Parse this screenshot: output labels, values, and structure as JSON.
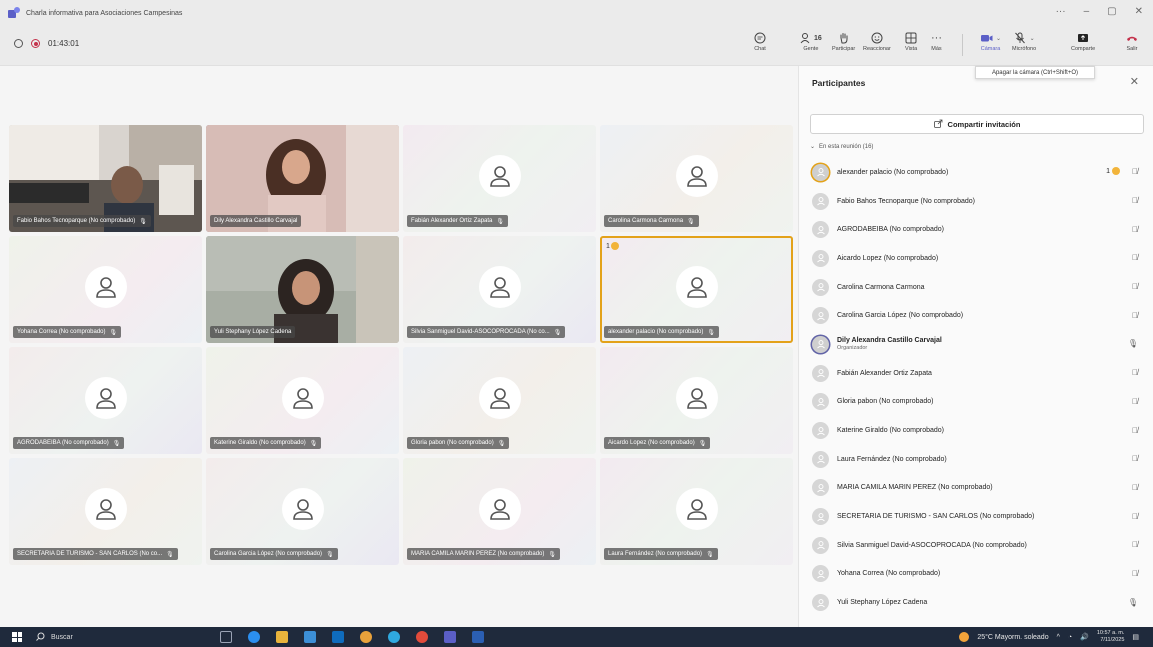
{
  "window": {
    "title": "Charla informativa para Asociaciones Campesinas",
    "controls": [
      "···",
      "–",
      "▢",
      "✕"
    ]
  },
  "meeting": {
    "timer": "01:43:01"
  },
  "toolbar": {
    "chat": "Chat",
    "people": "Gente",
    "people_count": "16",
    "raise": "Participar",
    "react": "Reaccionar",
    "view": "Vista",
    "more": "Más",
    "camera": "Cámara",
    "mic": "Micrófono",
    "share": "Comparte",
    "leave": "Salir",
    "camera_tooltip": "Apagar la cámara (Ctrl+Shift+O)"
  },
  "tiles": [
    {
      "name": "Fabio Bahos Tecnoparque (No comprobado)",
      "camera": true
    },
    {
      "name": "Dily Alexandra Castillo Carvajal",
      "camera": true
    },
    {
      "name": "Fabián Alexander Ortiz Zapata",
      "camera": false
    },
    {
      "name": "Carolina Carmona Carmona",
      "camera": false
    },
    {
      "name": "Yohana Correa (No comprobado)",
      "camera": false
    },
    {
      "name": "Yuli Stephany López Cadena",
      "camera": true
    },
    {
      "name": "Silvia Sanmiguel David-ASOCOPROCADA (No co...",
      "camera": false
    },
    {
      "name": "alexander palacio (No comprobado)",
      "camera": false,
      "hand_count": "1"
    },
    {
      "name": "AGRODABEIBA (No comprobado)",
      "camera": false
    },
    {
      "name": "Katerine Giraldo (No comprobado)",
      "camera": false
    },
    {
      "name": "Gloria pabon (No comprobado)",
      "camera": false
    },
    {
      "name": "Aicardo Lopez (No comprobado)",
      "camera": false
    },
    {
      "name": "SECRETARIA DE TURISMO - SAN CARLOS (No co...",
      "camera": false
    },
    {
      "name": "Carolina Garcia López (No comprobado)",
      "camera": false
    },
    {
      "name": "MARIA CAMILA MARIN PEREZ (No comprobado)",
      "camera": false
    },
    {
      "name": "Laura Fernández (No comprobado)",
      "camera": false
    }
  ],
  "panel": {
    "title": "Participantes",
    "invite": "Compartir invitación",
    "section": "En esta reunión (16)",
    "participants": [
      {
        "name": "alexander palacio (No comprobado)",
        "hand_count": "1",
        "muted": true
      },
      {
        "name": "Fabio Bahos Tecnoparque (No comprobado)",
        "muted": true
      },
      {
        "name": "AGRODABEIBA (No comprobado)",
        "muted": true
      },
      {
        "name": "Aicardo Lopez (No comprobado)",
        "muted": true
      },
      {
        "name": "Carolina Carmona Carmona",
        "muted": true
      },
      {
        "name": "Carolina Garcia López (No comprobado)",
        "muted": true
      },
      {
        "name": "Dily Alexandra Castillo Carvajal",
        "role": "Organizador",
        "muted": false
      },
      {
        "name": "Fabián Alexander Ortiz Zapata",
        "muted": true
      },
      {
        "name": "Gloria pabon (No comprobado)",
        "muted": true
      },
      {
        "name": "Katerine Giraldo (No comprobado)",
        "muted": true
      },
      {
        "name": "Laura Fernández (No comprobado)",
        "muted": true
      },
      {
        "name": "MARIA CAMILA MARIN PEREZ (No comprobado)",
        "muted": true
      },
      {
        "name": "SECRETARIA DE TURISMO - SAN CARLOS (No comprobado)",
        "muted": true
      },
      {
        "name": "Silvia Sanmiguel David-ASOCOPROCADA (No comprobado)",
        "muted": true
      },
      {
        "name": "Yohana Correa (No comprobado)",
        "muted": true
      },
      {
        "name": "Yuli Stephany López Cadena",
        "muted": false
      }
    ]
  },
  "taskbar": {
    "search": "Buscar",
    "weather": "25°C  Mayorm. soleado",
    "time": "10:57 a. m.",
    "date": "7/11/2025"
  },
  "colors": {
    "accent": "#6264a7",
    "hand": "#e3a21a",
    "record": "#c4314b",
    "leave": "#c4314b"
  }
}
